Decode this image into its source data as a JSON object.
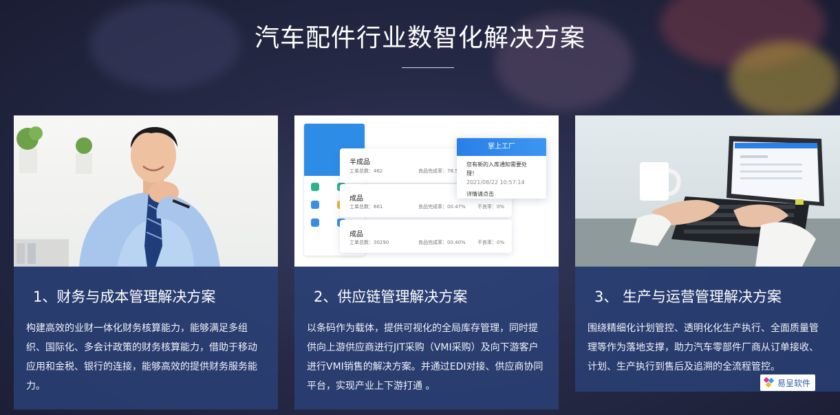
{
  "page": {
    "title": "汽车配件行业数智化解决方案"
  },
  "cards": [
    {
      "heading": "1、财务与成本管理解决方案",
      "text": "构建高效的业财一体化财务核算能力，能够满足多组织、国际化、多会计政策的财务核算能力，借助于移动应用和金税、银行的连接，能够高效的提供财务服务能力。",
      "image": "businessman-photo"
    },
    {
      "heading": "2、供应链管理解决方案",
      "text": "以条码作为载体，提供可视化的全局库存管理，同时提供向上游供应商进行JIT采购（VMI采购）及向下游客户进行VMI销售的解决方案。并通过EDI对接、供应商协同平台，实现产业上下游打通 。",
      "image": "app-screenshot",
      "mockup": {
        "panels": [
          {
            "name": "半成品",
            "line": "工单总数：462",
            "rate": "良品完成率：78.55%",
            "extra": ""
          },
          {
            "name": "成品",
            "line": "工单总数：661",
            "rate": "良品完成率：00.47%",
            "extra": "不良率：0%"
          },
          {
            "name": "成品",
            "line": "工单总数：30290",
            "rate": "良品完成率：00.40%",
            "extra": "不良率：0%"
          }
        ],
        "notice": {
          "header": "掌上工厂",
          "message": "您有新的入库通知需要处理！",
          "time": "2021/08/22 10:57:14",
          "link": "详情请点击"
        }
      }
    },
    {
      "heading": "3、 生产与运营管理解决方案",
      "text": "围绕精细化计划管控、透明化化生产执行、全面质量管理等作为落地支撑，助力汽车零部件厂商从订单接收、计划、生产执行到售后及追溯的全流程管控。",
      "image": "laptop-typing-photo"
    }
  ],
  "watermark": {
    "text": "易呈软件",
    "icon": "yicheng-logo-icon"
  },
  "colors": {
    "card_body": "#2a427b",
    "accent_blue": "#2d8de6",
    "logo_text": "#2e5da8"
  }
}
